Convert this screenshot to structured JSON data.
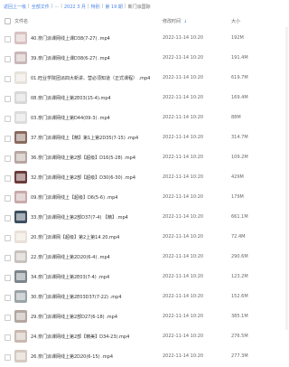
{
  "breadcrumb": [
    "返回上一级",
    "全部文件",
    "...",
    "2022 3 月",
    "特别",
    "第 19 期",
    "新门派国际"
  ],
  "header": {
    "name_label": "文件名",
    "time_label": "修改时间",
    "size_label": "大小",
    "sort_arrow": "↓"
  },
  "files": [
    {
      "name": "40.奈门派课网线上课D38(7-27) .mp4",
      "time": "2022-11-14 10:20",
      "size": "192M",
      "thumb": "#d9c2c2"
    },
    {
      "name": "39.奈门派课网线上课D38(6-27) .mp4",
      "time": "2022-11-14 10:20",
      "size": "191.4M",
      "thumb": "#c9b7b7"
    },
    {
      "name": "01.旺业学院团派四大新讲、营必须知道（正式课程） .mp4",
      "time": "2022-11-14 10:20",
      "size": "619.7M",
      "thumb": "#e8e2dc"
    },
    {
      "name": "08.奈门派课网线上第2E03(15-4).mp4",
      "time": "2022-11-14 10:20",
      "size": "169.4M",
      "thumb": "#d8d8d8"
    },
    {
      "name": "03.奈门派课网线上第D44(09-3) .mp4",
      "time": "2022-11-14 10:20",
      "size": "88M",
      "thumb": "#dcdcdc"
    },
    {
      "name": "37.奈门派课网线上【精】第1上第2D35(7-15) .mp4",
      "time": "2022-11-14 10:20",
      "size": "314.7M",
      "thumb": "#8a6a5e"
    },
    {
      "name": "36.奈门派课网线上第2部【超级】D16(5-28) .mp4",
      "time": "2022-11-14 10:20",
      "size": "109.2M",
      "thumb": "#b7a6a0"
    },
    {
      "name": "32.奈门派课网线上第2部【超级】D30(6-30) .mp4",
      "time": "2022-11-14 10:20",
      "size": "429M",
      "thumb": "#6b3b3b"
    },
    {
      "name": "09.奈门派课网线上【超级】D6(5-6) .mp4",
      "time": "2022-11-14 10:20",
      "size": "179M",
      "thumb": "#c8a9a9"
    },
    {
      "name": "33.奈门派课网线上第2部D37(7-4) 【精】.mp4",
      "time": "2022-11-14 10:20",
      "size": "661.1M",
      "thumb": "#3d4f5f"
    },
    {
      "name": "20.奈门派课网【超级】第2上第14 20.mp4",
      "time": "2022-11-14 10:20",
      "size": "72.4M",
      "thumb": "#e9e1d8"
    },
    {
      "name": "22.奈门派课网线上第2D20(6-4) .mp4",
      "time": "2022-11-14 10:20",
      "size": "290.6M",
      "thumb": "#c7c2bd"
    },
    {
      "name": "34.奈门派课网线上第2E03(7-4) .mp4",
      "time": "2022-11-14 10:20",
      "size": "123.2M",
      "thumb": "#7b858c"
    },
    {
      "name": "30.奈门派课网线上第2E03D37(7-22) .mp4",
      "time": "2022-11-14 10:20",
      "size": "152.6M",
      "thumb": "#9aa3a8"
    },
    {
      "name": "29.奈门派课网线上第2部D27(6-18) .mp4",
      "time": "2022-11-14 10:20",
      "size": "385.1M",
      "thumb": "#b4a6a0"
    },
    {
      "name": "24.奈门派课网线上第2部【精美】D34-23).mp4",
      "time": "2022-11-14 10:20",
      "size": "276.5M",
      "thumb": "#c9b9b0"
    },
    {
      "name": "26.奈门派课网线上第2D20(6-15) .mp4",
      "time": "2022-11-14 10:20",
      "size": "277.3M",
      "thumb": "#d6c9c0"
    }
  ]
}
